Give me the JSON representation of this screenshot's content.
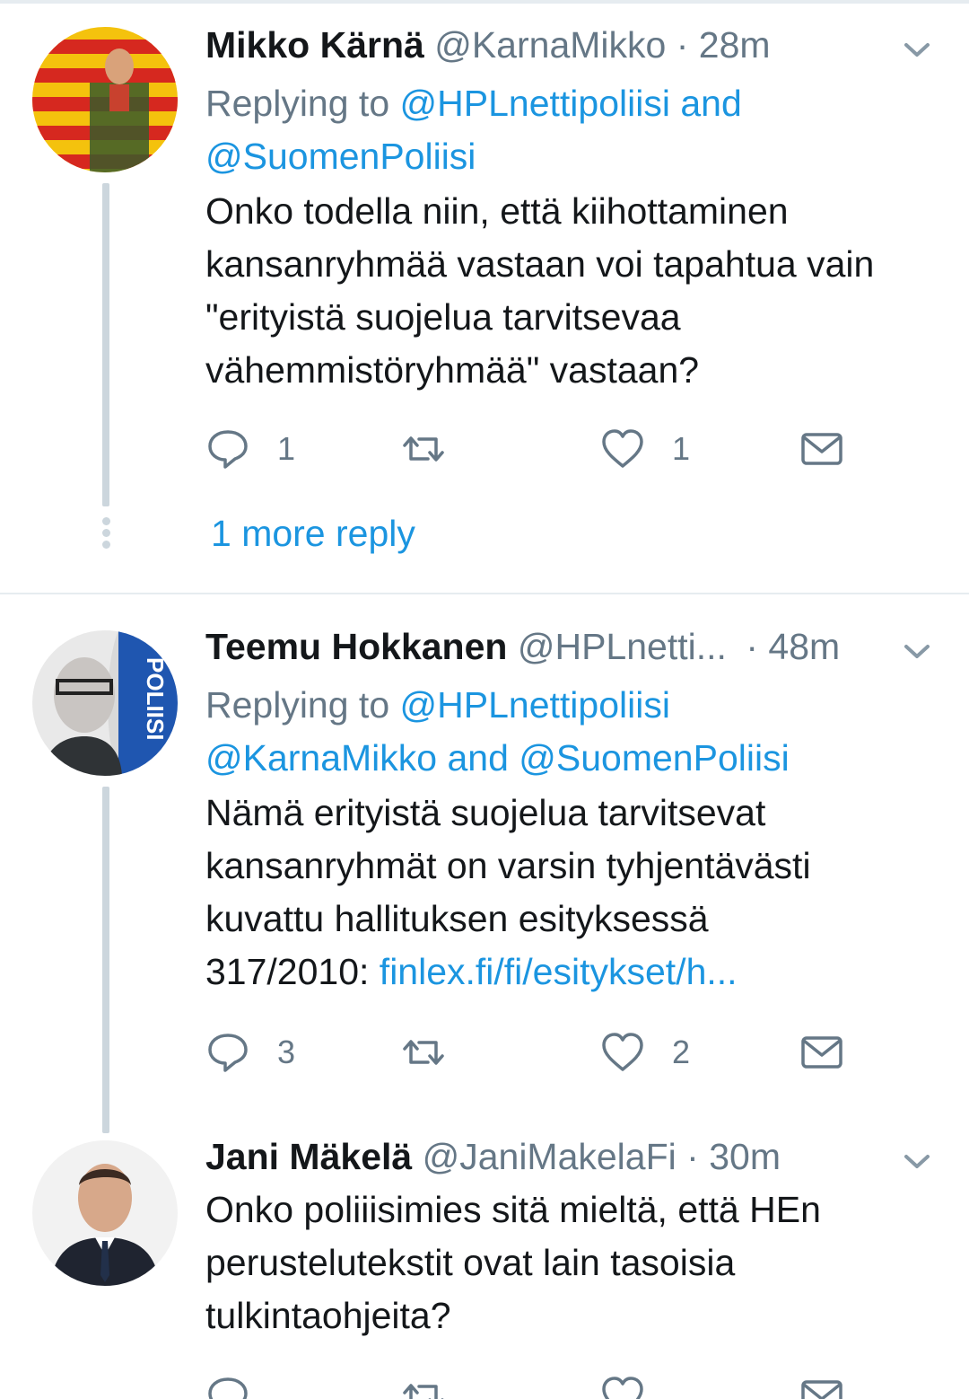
{
  "tweets": [
    {
      "name": "Mikko Kärnä",
      "handle": "@KarnaMikko",
      "sep": "·",
      "time": "28m",
      "replying_prefix": "Replying to",
      "replying_line1": "@HPLnettipoliisi and",
      "replying_line2": "@SuomenPoliisi",
      "text_lines": [
        "Onko todella niin, että kiihottaminen",
        "kansanryhmää vastaan voi tapahtua vain",
        "\"erityistä suojelua tarvitsevaa",
        "vähemmistöryhmää\" vastaan?"
      ],
      "reply_count": "1",
      "retweet_count": "",
      "like_count": "1",
      "more_replies": "1 more reply"
    },
    {
      "name": "Teemu Hokkanen",
      "handle": "@HPLnetti...",
      "sep": "·",
      "time": "48m",
      "replying_prefix": "Replying to",
      "replying_line1": "@HPLnettipoliisi",
      "replying_line2": "@KarnaMikko and @SuomenPoliisi",
      "text_lines": [
        "Nämä erityistä suojelua tarvitsevat",
        "kansanryhmät on varsin tyhjentävästi",
        "kuvattu hallituksen esityksessä"
      ],
      "text_last_prefix": "317/2010: ",
      "text_last_link": "finlex.fi/fi/esitykset/h...",
      "reply_count": "3",
      "retweet_count": "",
      "like_count": "2"
    },
    {
      "name": "Jani Mäkelä",
      "handle": "@JaniMakelaFi",
      "sep": "·",
      "time": "30m",
      "text_lines": [
        "Onko poliiisimies sitä mieltä, että HEn",
        "perustelutekstit ovat lain tasoisia",
        "tulkintaohjeita?"
      ]
    }
  ],
  "colors": {
    "link": "#1b95e0",
    "secondary_text": "#657786",
    "thread_line": "#ccd6dd",
    "divider": "#e6ecf0"
  },
  "icons": [
    "reply-icon",
    "retweet-icon",
    "like-icon",
    "direct-message-icon",
    "chevron-down-icon"
  ]
}
